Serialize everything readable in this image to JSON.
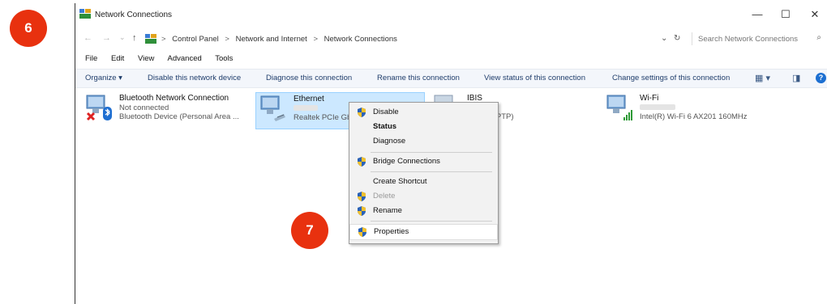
{
  "window": {
    "title": "Network Connections"
  },
  "controls": {
    "minimize": "—",
    "maximize": "☐",
    "close": "✕"
  },
  "address": {
    "back": "←",
    "forward": "→",
    "recent": "⌄",
    "up": "↑",
    "crumbs": [
      "Control Panel",
      "Network and Internet",
      "Network Connections"
    ],
    "separator": ">",
    "dropdown": "⌄",
    "refresh": "↻",
    "search_placeholder": "Search Network Connections",
    "search_icon": "⌕"
  },
  "menubar": [
    "File",
    "Edit",
    "View",
    "Advanced",
    "Tools"
  ],
  "commandbar": {
    "organize": "Organize ▾",
    "items": [
      "Disable this network device",
      "Diagnose this connection",
      "Rename this connection",
      "View status of this connection",
      "Change settings of this connection"
    ],
    "view_icon": "▦ ▾",
    "pane_icon": "◨",
    "help": "?"
  },
  "connections": [
    {
      "name": "Bluetooth Network Connection",
      "status": "Not connected",
      "device": "Bluetooth Device (Personal Area ...",
      "icon": "bluetooth-adapter-icon"
    },
    {
      "name": "Ethernet",
      "status": "",
      "device": "Realtek PCIe Gb",
      "icon": "ethernet-adapter-icon"
    },
    {
      "name": "IBIS",
      "status": "ected",
      "device": "niport (PPTP)",
      "icon": "vpn-adapter-icon"
    },
    {
      "name": "Wi-Fi",
      "status": "",
      "device": "Intel(R) Wi-Fi 6 AX201 160MHz",
      "icon": "wifi-adapter-icon"
    }
  ],
  "context_menu": [
    {
      "label": "Disable",
      "shield": true,
      "bold": false,
      "disabled": false
    },
    {
      "label": "Status",
      "shield": false,
      "bold": true,
      "disabled": false
    },
    {
      "label": "Diagnose",
      "shield": false,
      "bold": false,
      "disabled": false
    },
    {
      "label": "Bridge Connections",
      "shield": true,
      "bold": false,
      "disabled": false
    },
    {
      "label": "Create Shortcut",
      "shield": false,
      "bold": false,
      "disabled": false
    },
    {
      "label": "Delete",
      "shield": true,
      "bold": false,
      "disabled": true
    },
    {
      "label": "Rename",
      "shield": true,
      "bold": false,
      "disabled": false
    },
    {
      "label": "Properties",
      "shield": true,
      "bold": false,
      "disabled": false
    }
  ],
  "badges": {
    "step6": "6",
    "step7": "7"
  },
  "colors": {
    "badge": "#e8310f",
    "selection": "#cce8ff",
    "link": "#1f3d6b"
  }
}
